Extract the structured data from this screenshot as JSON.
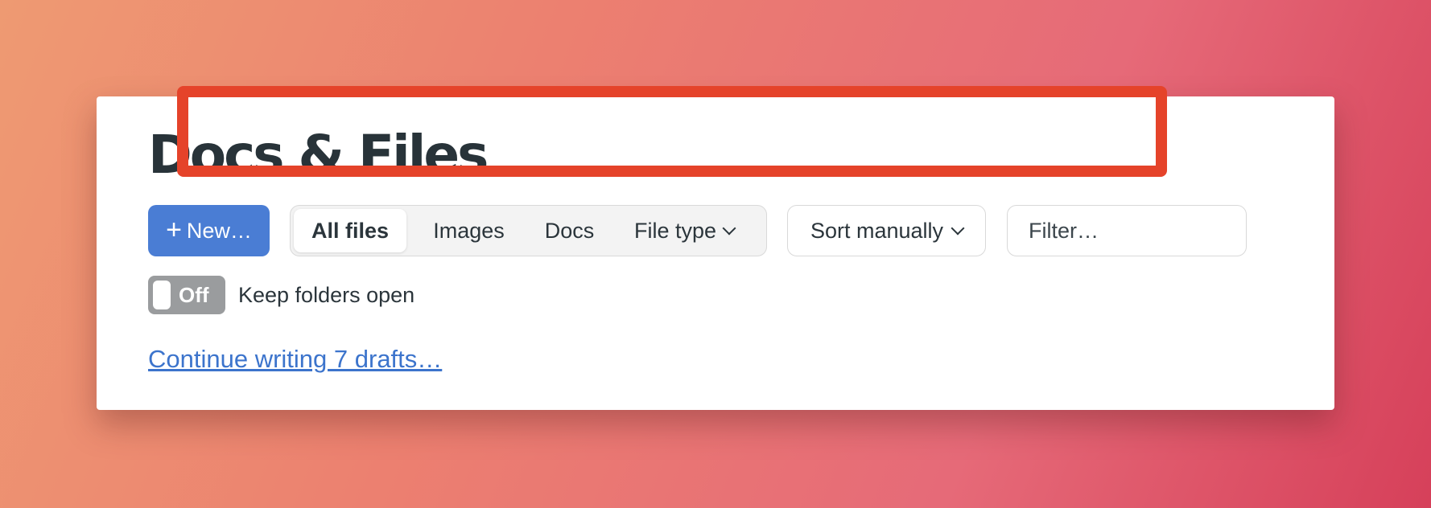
{
  "page": {
    "title": "Docs & Files"
  },
  "toolbar": {
    "new_label": "New…",
    "new_icon": "plus-icon",
    "tabs": [
      {
        "label": "All files",
        "active": true
      },
      {
        "label": "Images",
        "active": false
      },
      {
        "label": "Docs",
        "active": false
      },
      {
        "label": "File type",
        "active": false,
        "icon": "chevron-down-icon"
      }
    ],
    "sort_label": "Sort manually",
    "sort_icon": "chevron-down-icon",
    "filter_placeholder": "Filter…",
    "filter_value": ""
  },
  "options": {
    "toggle_state": "Off",
    "toggle_label": "Keep folders open"
  },
  "drafts": {
    "link_label": "Continue writing 7 drafts…"
  },
  "colors": {
    "primary": "#4a7dd4",
    "link": "#3c74cc",
    "highlight": "#e5432a",
    "toggle_off": "#9a9c9e",
    "text": "#283339"
  }
}
